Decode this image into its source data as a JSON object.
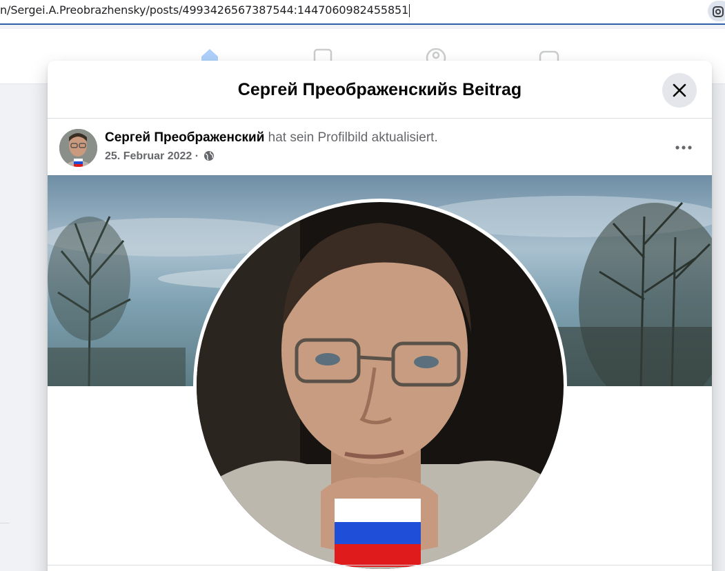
{
  "browser": {
    "url": "n/Sergei.A.Preobrazhensky/posts/4993426567387544:1447060982455851"
  },
  "dialog": {
    "title": "Сергей Преображенскийs Beitrag",
    "close_icon": "close-icon"
  },
  "post": {
    "author": "Сергей Преображенский",
    "action": "hat sein Profilbild aktualisiert.",
    "date": "25. Februar 2022",
    "separator": "·",
    "privacy_icon": "globe-icon",
    "more_icon": "more-horizontal-icon"
  },
  "colors": {
    "accent": "#1877f2",
    "address_underline": "#2f5fa8",
    "flag_white": "#ffffff",
    "flag_blue": "#1f4fd8",
    "flag_red": "#e01b1b"
  }
}
